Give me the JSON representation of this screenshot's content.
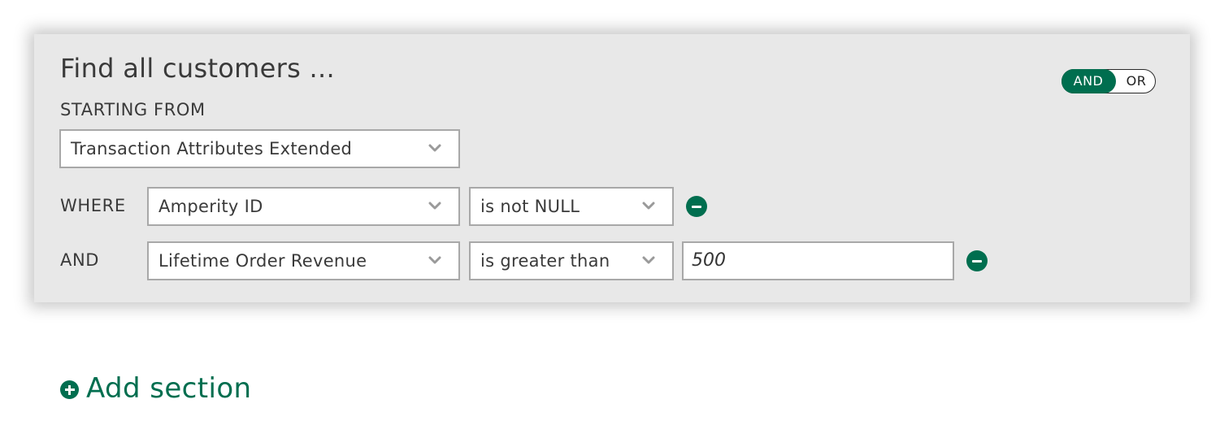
{
  "segment": {
    "title": "Find all customers ...",
    "logic_toggle": {
      "and_label": "AND",
      "or_label": "OR",
      "selected": "AND"
    },
    "starting_from_label": "STARTING FROM",
    "starting_table": "Transaction Attributes Extended",
    "conditions": [
      {
        "prefix": "WHERE",
        "field": "Amperity ID",
        "operator": "is not NULL",
        "value": ""
      },
      {
        "prefix": "AND",
        "field": "Lifetime Order Revenue",
        "operator": "is greater than",
        "value": "500"
      }
    ]
  },
  "add_section_label": "Add section",
  "colors": {
    "accent": "#006e4f",
    "panel_background": "#e8e8e8",
    "field_border": "#a8a8a8"
  },
  "icons": {
    "dropdown": "chevron-down-icon",
    "remove": "minus-circle-icon",
    "add": "plus-circle-icon"
  }
}
